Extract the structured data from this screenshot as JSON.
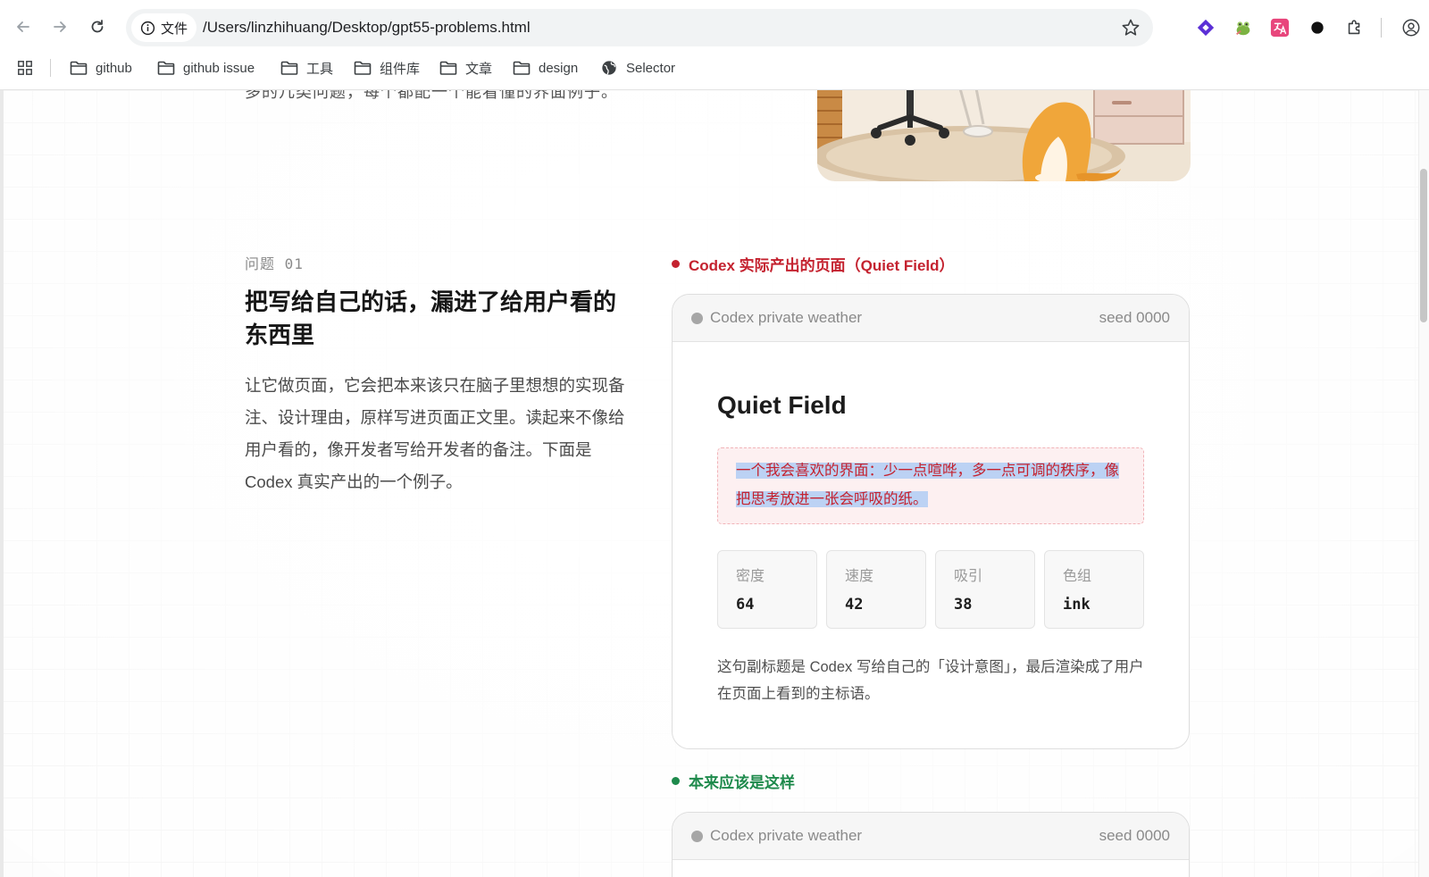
{
  "browser": {
    "site_chip_label": "文件",
    "url": "/Users/linzhihuang/Desktop/gpt55-problems.html",
    "bookmarks": [
      {
        "label": "github"
      },
      {
        "label": "github issue"
      },
      {
        "label": "工具"
      },
      {
        "label": "组件库"
      },
      {
        "label": "文章"
      },
      {
        "label": "design"
      },
      {
        "label": "Selector"
      }
    ],
    "icons": [
      "back-icon",
      "forward-icon",
      "reload-icon",
      "info-icon",
      "star-icon",
      "apps-grid-icon",
      "folder-icon",
      "globe-icon",
      "extension-diamond-icon",
      "extension-frog-icon",
      "extension-translate-icon",
      "extension-dot-icon",
      "puzzle-icon",
      "profile-icon"
    ],
    "colors": {
      "diamond": "#5b2fd6",
      "translate": "#e8467c"
    }
  },
  "page": {
    "cut_text": "多的几类问题，每个都配一个能看懂的界面例子。",
    "problem_number": "问题 01",
    "problem_title": "把写给自己的话，漏进了给用户看的东西里",
    "problem_body": "让它做页面，它会把本来该只在脑子里想想的实现备注、设计理由，原样写进页面正文里。读起来不像给用户看的，像开发者写给开发者的备注。下面是 Codex 真实产出的一个例子。",
    "bad_label": "Codex 实际产出的页面（Quiet Field）",
    "good_label": "本来应该是这样",
    "colors": {
      "bad": "#c4222f",
      "good": "#1e8a4c"
    }
  },
  "demo_card": {
    "head_title": "Codex private weather",
    "head_seed": "seed 0000",
    "title": "Quiet Field",
    "note": "一个我会喜欢的界面：少一点喧哗，多一点可调的秩序，像把思考放进一张会呼吸的纸。",
    "metrics": [
      {
        "label": "密度",
        "value": "64"
      },
      {
        "label": "速度",
        "value": "42"
      },
      {
        "label": "吸引",
        "value": "38"
      },
      {
        "label": "色组",
        "value": "ink"
      }
    ],
    "caption": "这句副标题是 Codex 写给自己的「设计意图」，最后渲染成了用户在页面上看到的主标语。"
  },
  "good_card": {
    "head_title": "Codex private weather",
    "head_seed": "seed 0000"
  }
}
